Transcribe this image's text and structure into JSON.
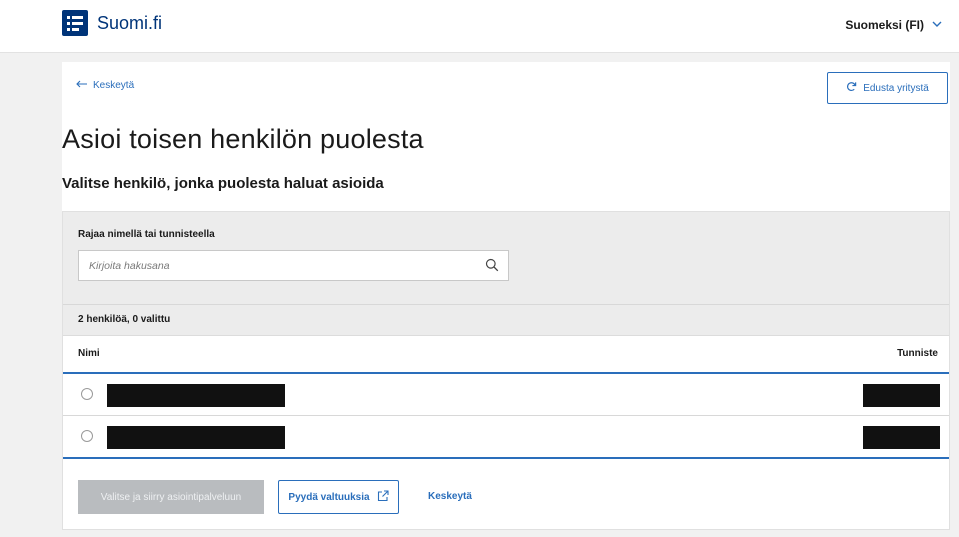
{
  "header": {
    "logo_text": "Suomi.fi",
    "language_label": "Suomeksi (FI)"
  },
  "nav": {
    "back_label": "Keskeytä",
    "represent_company_label": "Edusta yritystä"
  },
  "page": {
    "title": "Asioi toisen henkilön puolesta",
    "subtitle": "Valitse henkilö, jonka puolesta haluat asioida"
  },
  "filter": {
    "label": "Rajaa nimellä tai tunnisteella",
    "placeholder": "Kirjoita hakusana"
  },
  "list": {
    "count_text": "2 henkilöä, 0 valittu",
    "columns": {
      "name": "Nimi",
      "id": "Tunniste"
    },
    "rows": [
      {
        "selected": false,
        "name_redacted": true,
        "id_redacted": true
      },
      {
        "selected": false,
        "name_redacted": true,
        "id_redacted": true
      }
    ]
  },
  "actions": {
    "primary_label": "Valitse ja siirry asiointipalveluun",
    "primary_disabled": true,
    "request_label": "Pyydä valtuuksia",
    "cancel_label": "Keskeytä"
  },
  "colors": {
    "brand": "#003479",
    "accent": "#2a6ebb",
    "disabled": "#b9bcbf"
  }
}
